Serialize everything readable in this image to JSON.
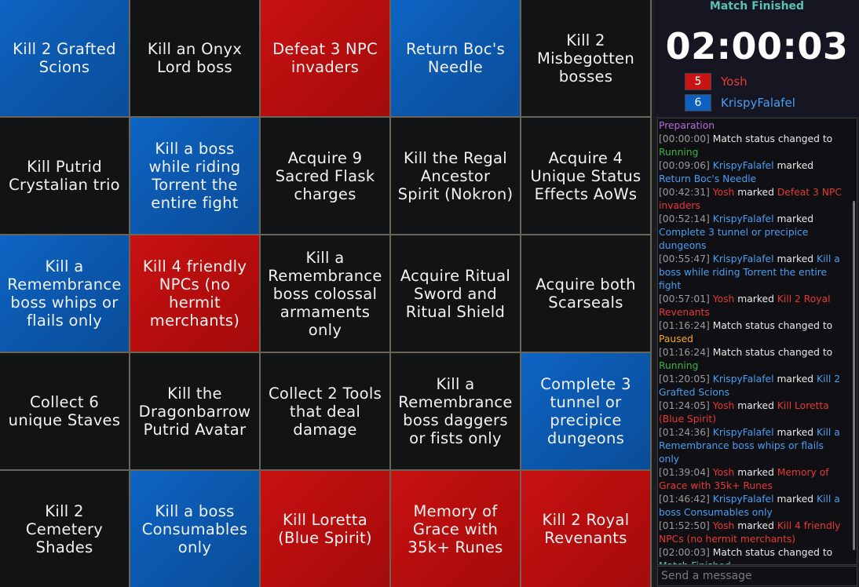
{
  "board": {
    "cells": [
      {
        "text": "Kill 2 Grafted Scions",
        "owner": "blue"
      },
      {
        "text": "Kill an Onyx Lord boss",
        "owner": "none"
      },
      {
        "text": "Defeat 3 NPC invaders",
        "owner": "red"
      },
      {
        "text": "Return Boc's Needle",
        "owner": "blue"
      },
      {
        "text": "Kill 2 Misbegotten bosses",
        "owner": "none"
      },
      {
        "text": "Kill Putrid Crystalian trio",
        "owner": "none"
      },
      {
        "text": "Kill a boss while riding Torrent the entire fight",
        "owner": "blue"
      },
      {
        "text": "Acquire 9 Sacred Flask charges",
        "owner": "none"
      },
      {
        "text": "Kill the Regal Ancestor Spirit (Nokron)",
        "owner": "none"
      },
      {
        "text": "Acquire 4 Unique Status Effects AoWs",
        "owner": "none"
      },
      {
        "text": "Kill a Remembrance boss whips or flails only",
        "owner": "blue"
      },
      {
        "text": "Kill 4 friendly NPCs (no hermit merchants)",
        "owner": "red"
      },
      {
        "text": "Kill a Remembrance boss colossal armaments only",
        "owner": "none"
      },
      {
        "text": "Acquire Ritual Sword and Ritual Shield",
        "owner": "none"
      },
      {
        "text": "Acquire both Scarseals",
        "owner": "none"
      },
      {
        "text": "Collect 6 unique Staves",
        "owner": "none"
      },
      {
        "text": "Kill the Dragonbarrow Putrid Avatar",
        "owner": "none"
      },
      {
        "text": "Collect 2 Tools that deal damage",
        "owner": "none"
      },
      {
        "text": "Kill a Remembrance boss daggers or fists only",
        "owner": "none"
      },
      {
        "text": "Complete 3 tunnel or precipice dungeons",
        "owner": "blue"
      },
      {
        "text": "Kill 2 Cemetery Shades",
        "owner": "none"
      },
      {
        "text": "Kill a boss Consumables only",
        "owner": "blue"
      },
      {
        "text": "Kill Loretta (Blue Spirit)",
        "owner": "red"
      },
      {
        "text": "Memory of Grace with 35k+ Runes",
        "owner": "red"
      },
      {
        "text": "Kill 2 Royal Revenants",
        "owner": "red"
      }
    ]
  },
  "status": {
    "match_status": "Match Finished",
    "timer": "02:00:03",
    "players": [
      {
        "score": "5",
        "name": "Yosh",
        "color": "#c81414"
      },
      {
        "score": "6",
        "name": "KrispyFalafel",
        "color": "#0d5fc0"
      }
    ]
  },
  "log": {
    "header": "Preparation",
    "entries": [
      {
        "ts": "[00:00:00]",
        "type": "status",
        "text": "Match status changed to",
        "status": "Running",
        "statusClass": "st-running"
      },
      {
        "ts": "[00:09:06]",
        "type": "mark",
        "player": "KrispyFalafel",
        "team": "blue",
        "verb": "marked",
        "goal": "Return Boc's Needle"
      },
      {
        "ts": "[00:42:31]",
        "type": "mark",
        "player": "Yosh",
        "team": "red",
        "verb": "marked",
        "goal": "Defeat 3 NPC invaders"
      },
      {
        "ts": "[00:52:14]",
        "type": "mark",
        "player": "KrispyFalafel",
        "team": "blue",
        "verb": "marked",
        "goal": "Complete 3 tunnel or precipice dungeons"
      },
      {
        "ts": "[00:55:47]",
        "type": "mark",
        "player": "KrispyFalafel",
        "team": "blue",
        "verb": "marked",
        "goal": "Kill a boss while riding Torrent the entire fight"
      },
      {
        "ts": "[00:57:01]",
        "type": "mark",
        "player": "Yosh",
        "team": "red",
        "verb": "marked",
        "goal": "Kill 2 Royal Revenants"
      },
      {
        "ts": "[01:16:24]",
        "type": "status",
        "text": "Match status changed to",
        "status": "Paused",
        "statusClass": "st-paused"
      },
      {
        "ts": "[01:16:24]",
        "type": "status",
        "text": "Match status changed to",
        "status": "Running",
        "statusClass": "st-running"
      },
      {
        "ts": "[01:20:05]",
        "type": "mark",
        "player": "KrispyFalafel",
        "team": "blue",
        "verb": "marked",
        "goal": "Kill 2 Grafted Scions"
      },
      {
        "ts": "[01:24:05]",
        "type": "mark",
        "player": "Yosh",
        "team": "red",
        "verb": "marked",
        "goal": "Kill Loretta (Blue Spirit)"
      },
      {
        "ts": "[01:24:36]",
        "type": "mark",
        "player": "KrispyFalafel",
        "team": "blue",
        "verb": "marked",
        "goal": "Kill a Remembrance boss whips or flails only"
      },
      {
        "ts": "[01:39:04]",
        "type": "mark",
        "player": "Yosh",
        "team": "red",
        "verb": "marked",
        "goal": "Memory of Grace with 35k+ Runes"
      },
      {
        "ts": "[01:46:42]",
        "type": "mark",
        "player": "KrispyFalafel",
        "team": "blue",
        "verb": "marked",
        "goal": "Kill a boss Consumables only"
      },
      {
        "ts": "[01:52:50]",
        "type": "mark",
        "player": "Yosh",
        "team": "red",
        "verb": "marked",
        "goal": "Kill 4 friendly NPCs (no hermit merchants)"
      },
      {
        "ts": "[02:00:03]",
        "type": "status",
        "text": "Match status changed to",
        "status": "Match Finished",
        "statusClass": "st-finished"
      }
    ]
  },
  "chat": {
    "placeholder": "Send a message"
  }
}
